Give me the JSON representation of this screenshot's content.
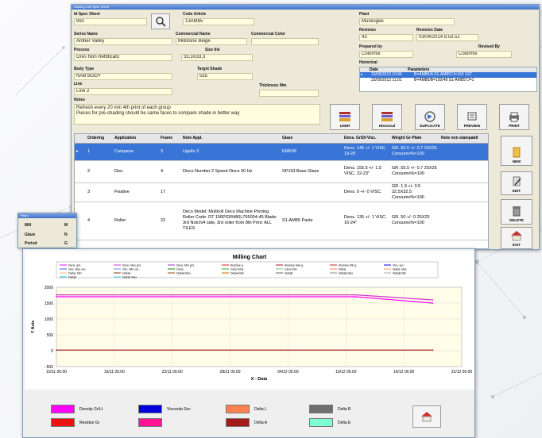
{
  "main": {
    "title": "Glazing Line Spec Sheet",
    "id_spec_label": "Id Spec Sheet",
    "id_spec_value": "892",
    "code_article_label": "Code Article",
    "code_article_value": "13AM85",
    "series_label": "Series Name",
    "series_value": "Amber Valley",
    "commercial_name_label": "Commercial Name",
    "commercial_name_value": "Millstone Beige",
    "commercial_color_label": "Commercial Color",
    "process_label": "Process",
    "process_value": "Gres Non Rettificato",
    "size_label": "Size tile",
    "size_value": "33,3X33,3",
    "body_type_label": "Body Type",
    "body_type_value": "NAB BODY",
    "target_shade_label": "Target Shade",
    "target_shade_value": "555",
    "line_label": "Line",
    "line_value": "Line 2",
    "thickness_label": "Thickness Mm",
    "notes_label": "Notes",
    "notes_line1": "Refresh every 20 min 4th print of each group",
    "notes_line2": "Pieces for pre-shading should be same faces to compare shade in better way",
    "plant_label": "Plant",
    "plant_value": "Muskogee",
    "revision_label": "Revision",
    "revision_value": "43",
    "revision_date_label": "Revision Date",
    "revision_date_value": "03/04/2014 8.53.51",
    "prepared_by_label": "Prepared by",
    "prepared_by_value": "Colormix",
    "revised_by_label": "Revised By",
    "revised_by_value": "Colormix",
    "historical_label": "Historical",
    "historical_col_date": "Date",
    "historical_col_params": "Parameters",
    "historical_rows": [
      {
        "date": "23/09/2013 10.56",
        "params": "B=AM85/A S1-AM857J=150 1ST"
      },
      {
        "date": "23/09/2013 11.01",
        "params": "B=AM85/B=150/48 S1-AM857J=1"
      }
    ],
    "buttons": {
      "user": "USER",
      "historical": "Historical",
      "duplicate": "DUPLICATE",
      "preview": "PREVIEW",
      "print": "PRINT"
    },
    "side_buttons": {
      "new": "NEW",
      "edit": "EDIT",
      "delete": "DELETE",
      "exit": "EXIT"
    },
    "table": {
      "headers": [
        "Ordering",
        "Application",
        "Frame",
        "Note Appl.",
        "Glaze",
        "Dens. Gr/Dl-Visc.",
        "Weight Gr-Plate",
        "Note non stampabil"
      ],
      "rows": [
        {
          "ordering": "1",
          "application": "Campana",
          "frame": "3",
          "note": "Ugello 3",
          "glaze": "EMK06",
          "dens": "Dens. 145 +/- 1 VISC. 19-26'",
          "weight": "GR. 55.5 +/- 0.7 25X25 Consumo%=100"
        },
        {
          "ordering": "2",
          "application": "Disc",
          "frame": "4",
          "note": "Discs Number 2 Speed Discs 30 Hz",
          "glaze": "SP193 Base Glaze",
          "dens": "Dens. 155.5 +/- 1.5 VISC. 22-23\"",
          "weight": "GR. 55.5 +/- 0.7 25X25 Consumo%=100"
        },
        {
          "ordering": "3",
          "application": "Fixative",
          "frame": "17",
          "note": "",
          "glaze": "",
          "dens": "Dens. 0 +/- 0 VISC.",
          "weight": "GR. 1.9 +/- 0.5 32.5X32.5 Consumo%=100"
        },
        {
          "ordering": "4",
          "application": "Roller",
          "frame": "22",
          "note": "Deco Model: Multiroll Deco Machine Printing Roller Code: DT 106P/DR480L755004-45 Blade: 3rd Notch/4 side, 3rd roller from 8th Print: ALL TILES",
          "glaze": "S1-AM85 Paste",
          "dens": "Dens. 135 +/- 1 VISC. 16-24\"",
          "weight": "GR. 50 +/- 0 25X25 Consumo%=100"
        }
      ]
    }
  },
  "repo": {
    "title": "Repo",
    "mill_label": "Mill",
    "glaze_label": "Glaze",
    "period_label": "Period"
  },
  "chart_window": {
    "swatches": [
      {
        "label": "Density Gr/Lt",
        "color": "#ff00ff"
      },
      {
        "label": "Viscosita Sec",
        "color": "#0000dd"
      },
      {
        "label": "Delta L",
        "color": "#ff8050"
      },
      {
        "label": "Delta B",
        "color": "#6e6e6e"
      },
      {
        "label": "Residue Gr",
        "color": "#ee1111"
      },
      {
        "label": "",
        "color": "#ff1493"
      },
      {
        "label": "Delta A",
        "color": "#a31a1a"
      },
      {
        "label": "Delta E",
        "color": "#7fffd4"
      }
    ]
  },
  "chart_data": {
    "type": "line",
    "title": "Milling Chart",
    "xlabel": "X - Data",
    "ylabel": "Y Axis",
    "ylim": [
      -500,
      2000
    ],
    "yticks": [
      "2000",
      "1500",
      "1000",
      "500",
      "0",
      "-500"
    ],
    "xticks": [
      "10/11 00.00",
      "16/11 00.00",
      "22/11 00.00",
      "28/11 00.00",
      "04/12 00.00",
      "10/12 00.00",
      "16/12 00.00",
      "22/12 00.00"
    ],
    "legend_entries": [
      "Dens. gr/L",
      "Dens. Max gr/L",
      "Dens. Min gr/L",
      "Residue g",
      "Residue Max g",
      "Residue Min g",
      "Visc. sec",
      "Visc. Max sec",
      "Visc. Min sec",
      "Gloss",
      "Gloss Max",
      "Gloss Min",
      "DeltaL",
      "DeltaL Max",
      "DeltaL Min",
      "DeltaA",
      "DeltaA Max",
      "DeltaA Min",
      "DeltaB",
      "DeltaB Max",
      "DeltaB Min",
      "DeltaE",
      "DeltaE Max"
    ],
    "legend_placement": "top",
    "grid": true,
    "series": [
      {
        "name": "Dens. Max gr/L",
        "color": "#cc33cc",
        "x": [
          "10/11",
          "11/12",
          "19/12"
        ],
        "values": [
          1760,
          1760,
          1600
        ]
      },
      {
        "name": "Dens. gr/L",
        "color": "#ff00ff",
        "x": [
          "10/11",
          "11/12",
          "19/12"
        ],
        "values": [
          1700,
          1700,
          1500
        ]
      },
      {
        "name": "Residue g",
        "color": "#a31a1a",
        "x": [
          "10/11",
          "19/12"
        ],
        "values": [
          20,
          20
        ]
      }
    ]
  }
}
